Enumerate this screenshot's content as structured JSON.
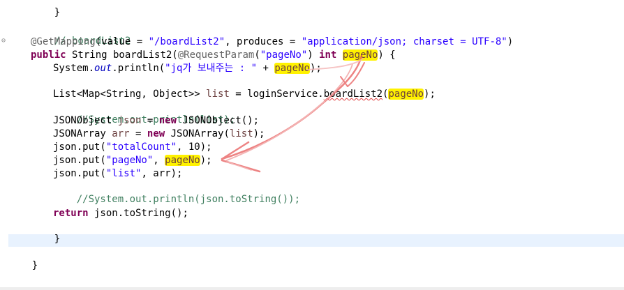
{
  "code": {
    "line_brace_top": "}",
    "comment_boardlist2": "// boardList2",
    "annotation": "@GetMapping",
    "ann_value_key": "(value = ",
    "ann_value_str": "\"/boardList2\"",
    "ann_produces_key": ", produces = ",
    "ann_produces_str": "\"application/json; charset = UTF-8\"",
    "ann_close": ")",
    "kw_public": "public",
    "sig_type_name": " String boardList2(",
    "req_param": "@RequestParam",
    "req_paren_open": "(",
    "req_param_str": "\"pageNo\"",
    "req_paren_close": ")",
    "kw_int": "int",
    "param_pageNo": "pageNo",
    "sig_close": ") {",
    "sysout_prefix": "System.",
    "sysout_field": "out",
    "sysout_println": ".println(",
    "sysout_str": "\"jq가 보내주는 : \"",
    "sysout_plus": " + ",
    "sysout_var": "pageNo",
    "sysout_end": ");",
    "list_decl_type": "List<Map<String, Object>> ",
    "list_var": "list",
    "list_assign": " = loginService.",
    "list_method": "boardList2",
    "list_open": "(",
    "list_arg": "pageNo",
    "list_end": ");",
    "comment_print_list": "//System.out.println(list);",
    "json_decl_type": "JSONObject ",
    "json_var": "json",
    "json_assign": " = ",
    "kw_new": "new",
    "json_ctor": " JSONObject();",
    "arr_decl_type": "JSONArray ",
    "arr_var": "arr",
    "arr_assign": " = ",
    "kw_new2": "new",
    "arr_ctor": " JSONArray(",
    "arr_arg": "list",
    "arr_end": ");",
    "put1_prefix": "json.put(",
    "put1_str": "\"totalCount\"",
    "put1_end": ", 10);",
    "put2_prefix": "json.put(",
    "put2_str": "\"pageNo\"",
    "put2_comma": ", ",
    "put2_var": "pageNo",
    "put2_end": ");",
    "put3_prefix": "json.put(",
    "put3_str": "\"list\"",
    "put3_end": ", arr);",
    "comment_print_json": "//System.out.println(json.toString());",
    "kw_return": "return",
    "return_expr": " json.toString();",
    "method_close": "}",
    "class_close": "}"
  },
  "annotations": {
    "highlight_color": "#fff200",
    "arrow_color": "#e85a5a"
  },
  "gutter": {
    "fold_icon": "fold-collapse-icon",
    "fold_glyph": "⊖"
  }
}
